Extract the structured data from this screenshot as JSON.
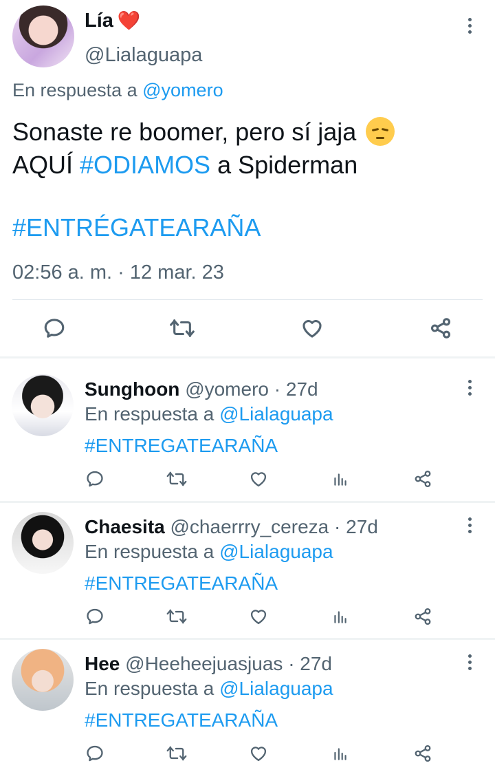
{
  "main_tweet": {
    "name": "Lía",
    "name_emoji": "❤️",
    "handle": "@Lialaguapa",
    "reply_prefix": "En respuesta a",
    "reply_mention": "@yomero",
    "line1": "Sonaste re boomer, pero sí jaja",
    "line2_pre": "AQUÍ",
    "line2_hashtag": "#ODIAMOS",
    "line2_post": "a Spiderman",
    "hashtag": "#ENTRÉGATEARAÑA",
    "timestamp": "02:56 a. m. · 12 mar. 23",
    "actions": [
      "reply-icon",
      "retweet-icon",
      "like-icon",
      "share-icon"
    ]
  },
  "replies": [
    {
      "name": "Sunghoon",
      "handle": "@yomero",
      "time": "· 27d",
      "reply_prefix": "En respuesta a",
      "reply_mention": "@Lialaguapa",
      "text": "#ENTREGATEARAÑA"
    },
    {
      "name": "Chaesita",
      "handle": "@chaerrry_cereza",
      "time": "· 27d",
      "reply_prefix": "En respuesta a",
      "reply_mention": "@Lialaguapa",
      "text": "#ENTREGATEARAÑA"
    },
    {
      "name": "Hee",
      "handle": "@Heeheejuasjuas",
      "time": "· 27d",
      "reply_prefix": "En respuesta a",
      "reply_mention": "@Lialaguapa",
      "text": "#ENTREGATEARAÑA"
    }
  ],
  "colors": {
    "link": "#1d9bf0",
    "secondary_text": "#536471",
    "heart": "#e0245e"
  }
}
